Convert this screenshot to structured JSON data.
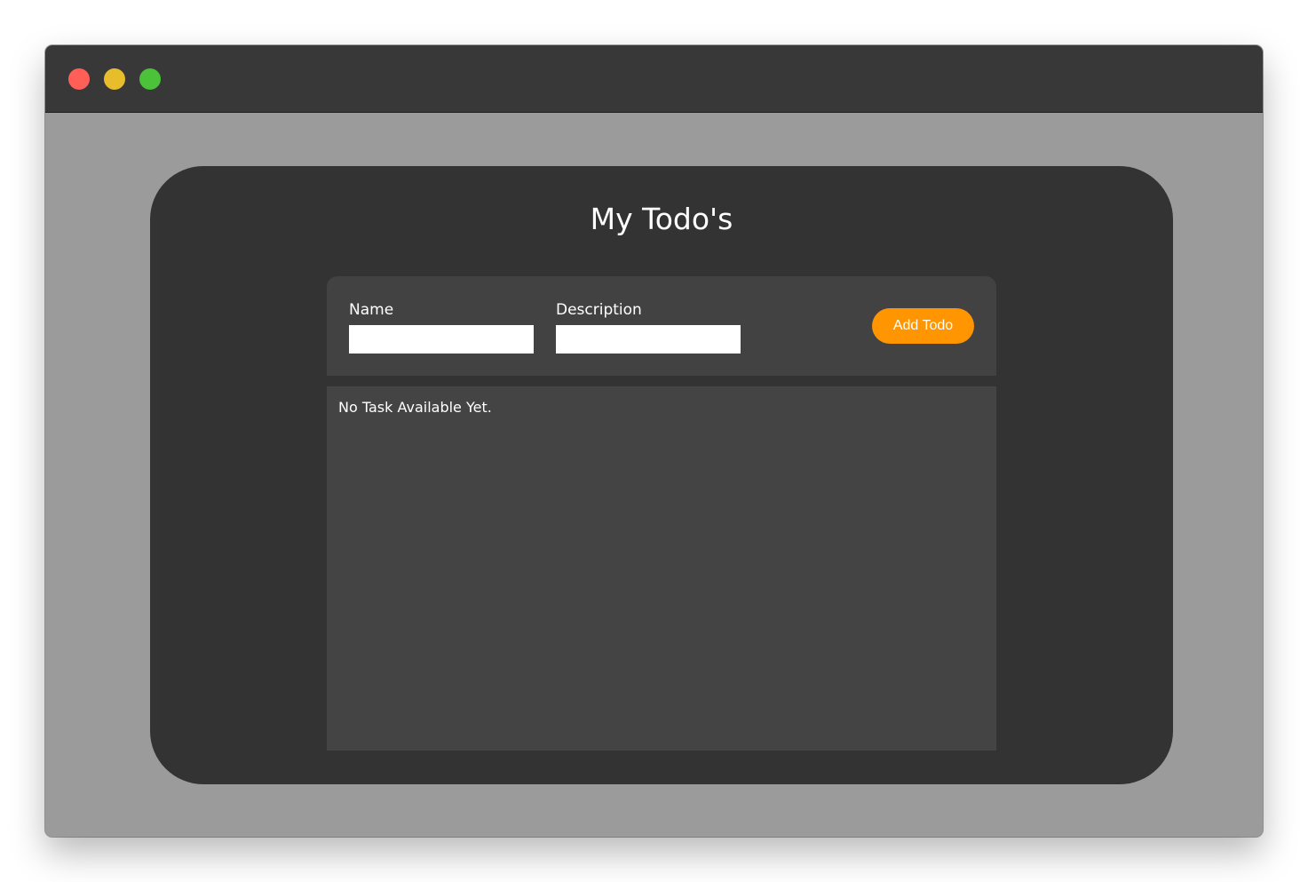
{
  "window": {
    "controls": [
      {
        "name": "close",
        "color": "#ff5f57"
      },
      {
        "name": "minimize",
        "color": "#e8bd2c"
      },
      {
        "name": "maximize",
        "color": "#4cc13a"
      }
    ]
  },
  "app": {
    "title": "My Todo's",
    "form": {
      "name_label": "Name",
      "name_value": "",
      "description_label": "Description",
      "description_value": "",
      "add_button_label": "Add Todo"
    },
    "list": {
      "empty_message": "No Task Available Yet."
    }
  },
  "colors": {
    "accent": "#ff9500",
    "card_background": "#333333",
    "panel_background": "#424242",
    "window_background": "#9b9b9b"
  }
}
